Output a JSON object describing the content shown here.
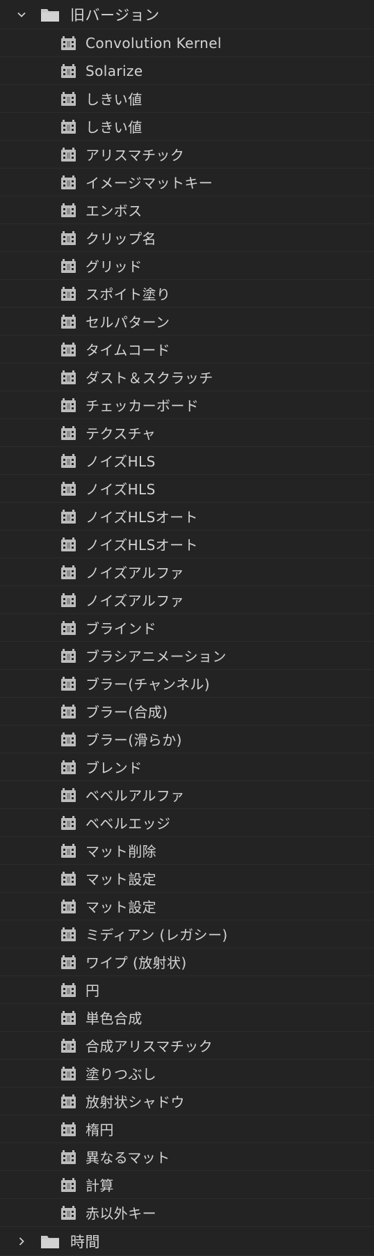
{
  "folders": [
    {
      "label": "旧バージョン",
      "expanded": true,
      "icon": "folder-icon",
      "items": [
        "Convolution Kernel",
        "Solarize",
        "しきい値",
        "しきい値",
        "アリスマチック",
        "イメージマットキー",
        "エンボス",
        "クリップ名",
        "グリッド",
        "スポイト塗り",
        "セルパターン",
        "タイムコード",
        "ダスト＆スクラッチ",
        "チェッカーボード",
        "テクスチャ",
        "ノイズHLS",
        "ノイズHLS",
        "ノイズHLSオート",
        "ノイズHLSオート",
        "ノイズアルファ",
        "ノイズアルファ",
        "ブラインド",
        "ブラシアニメーション",
        "ブラー(チャンネル)",
        "ブラー(合成)",
        "ブラー(滑らか)",
        "ブレンド",
        "ベベルアルファ",
        "ベベルエッジ",
        "マット削除",
        "マット設定",
        "マット設定",
        "ミディアン (レガシー)",
        "ワイプ (放射状)",
        "円",
        "単色合成",
        "合成アリスマチック",
        "塗りつぶし",
        "放射状シャドウ",
        "楕円",
        "異なるマット",
        "計算",
        "赤以外キー"
      ]
    },
    {
      "label": "時間",
      "expanded": false,
      "icon": "folder-icon",
      "items": []
    }
  ],
  "item_icon": "effect-preset-icon",
  "colors": {
    "background": "#232323",
    "row_divider": "#2c2c2c",
    "text": "#d4d4d4",
    "icon": "#bdbdbd"
  }
}
